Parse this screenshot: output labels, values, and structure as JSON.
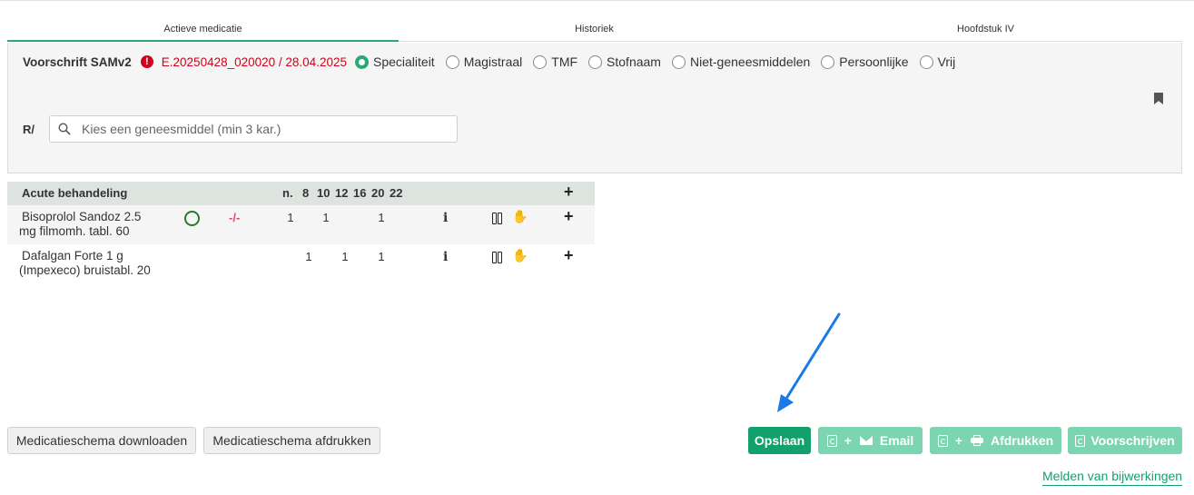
{
  "tabs": [
    {
      "label": "Actieve medicatie",
      "active": true
    },
    {
      "label": "Historiek",
      "active": false
    },
    {
      "label": "Hoofdstuk IV",
      "active": false
    }
  ],
  "prescription": {
    "label": "Voorschrift SAMv2",
    "warning_icon": "exclamation-circle-icon",
    "id_date": "E.20250428_020020 / 28.04.2025",
    "radio_options": [
      {
        "label": "Specialiteit",
        "checked": true
      },
      {
        "label": "Magistraal",
        "checked": false
      },
      {
        "label": "TMF",
        "checked": false
      },
      {
        "label": "Stofnaam",
        "checked": false
      },
      {
        "label": "Niet-geneesmiddelen",
        "checked": false
      },
      {
        "label": "Persoonlijke",
        "checked": false
      },
      {
        "label": "Vrij",
        "checked": false
      }
    ],
    "r_label": "R/",
    "search_placeholder": "Kies een geneesmiddel (min 3 kar.)"
  },
  "medication_table": {
    "header": {
      "title": "Acute behandeling",
      "n": "n.",
      "h8": "8",
      "h10": "10",
      "h12": "12",
      "h16": "16",
      "h20": "20",
      "h22": "22",
      "add": "+"
    },
    "rows": [
      {
        "name_line1": "Bisoprolol Sandoz 2.5",
        "name_line2": "mg filmomh. tabl. 60",
        "status_icon": "circle-outline-icon",
        "dash": "-/-",
        "n": "1",
        "v8": "",
        "v10": "1",
        "v12": "",
        "v16": "",
        "v20": "1",
        "v22": "",
        "add": "+"
      },
      {
        "name_line1": "Dafalgan Forte 1 g",
        "name_line2": "(Impexeco) bruistabl. 20",
        "status_icon": "",
        "dash": "",
        "n": "",
        "v8": "1",
        "v10": "",
        "v12": "1",
        "v16": "",
        "v20": "1",
        "v22": "",
        "add": "+"
      }
    ]
  },
  "buttons": {
    "download": "Medicatieschema downloaden",
    "print_schema": "Medicatieschema afdrukken",
    "save": "Opslaan",
    "email": "Email",
    "print": "Afdrukken",
    "prescribe": "Voorschrijven",
    "plus": "+"
  },
  "link": "Melden van bijwerkingen",
  "colors": {
    "accent": "#12a06c",
    "accent_light": "#7dd4b0",
    "warning": "#d0021b",
    "annotation_arrow": "#1a7be8"
  }
}
